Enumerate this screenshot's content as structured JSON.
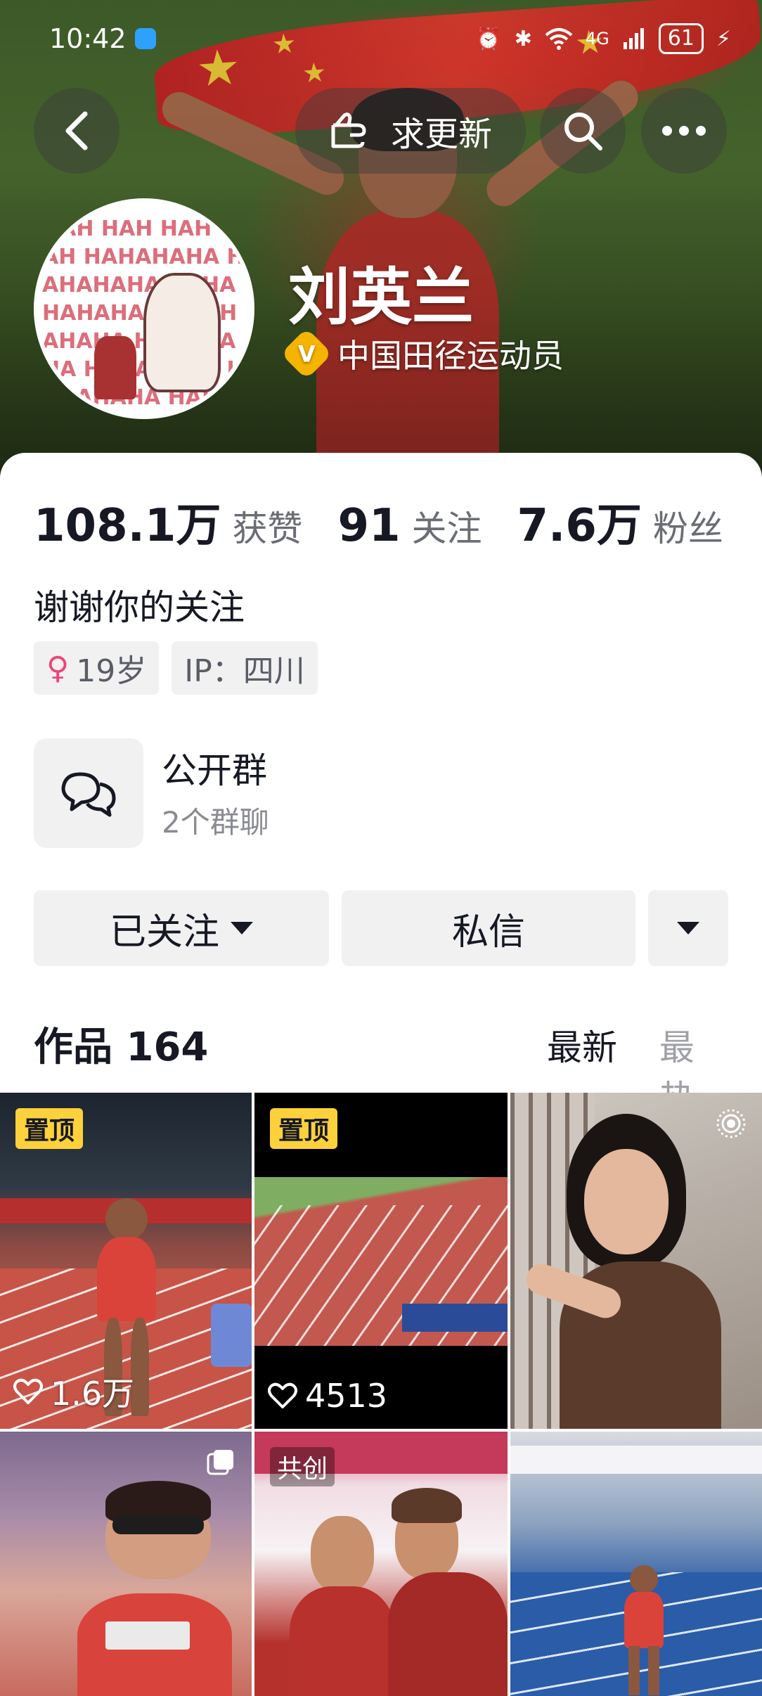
{
  "status_bar": {
    "time": "10:42",
    "network": "4G",
    "battery": "61"
  },
  "top_nav": {
    "update_label": "求更新"
  },
  "profile": {
    "name": "刘英兰",
    "verify_text": "中国田径运动员",
    "stats": [
      {
        "value": "108.1万",
        "label": "获赞"
      },
      {
        "value": "91",
        "label": "关注"
      },
      {
        "value": "7.6万",
        "label": "粉丝"
      }
    ],
    "bio": "谢谢你的关注",
    "tags": {
      "age": "19岁",
      "ip": "IP：四川"
    },
    "group": {
      "title": "公开群",
      "subtitle": "2个群聊"
    }
  },
  "actions": {
    "follow_label": "已关注",
    "dm_label": "私信"
  },
  "works": {
    "title": "作品 164",
    "sort_latest": "最新",
    "sort_hot": "最热"
  },
  "grid": {
    "pin_label": "置顶",
    "cocreate_label": "共创",
    "items": [
      {
        "likes": "1.6万"
      },
      {
        "likes": "4513"
      }
    ]
  },
  "colors": {
    "accent_yellow": "#fcd13b",
    "verify_badge": "#f4b400",
    "female_pink": "#f0437a",
    "text_primary": "#161823",
    "text_secondary": "#6b6d75"
  }
}
